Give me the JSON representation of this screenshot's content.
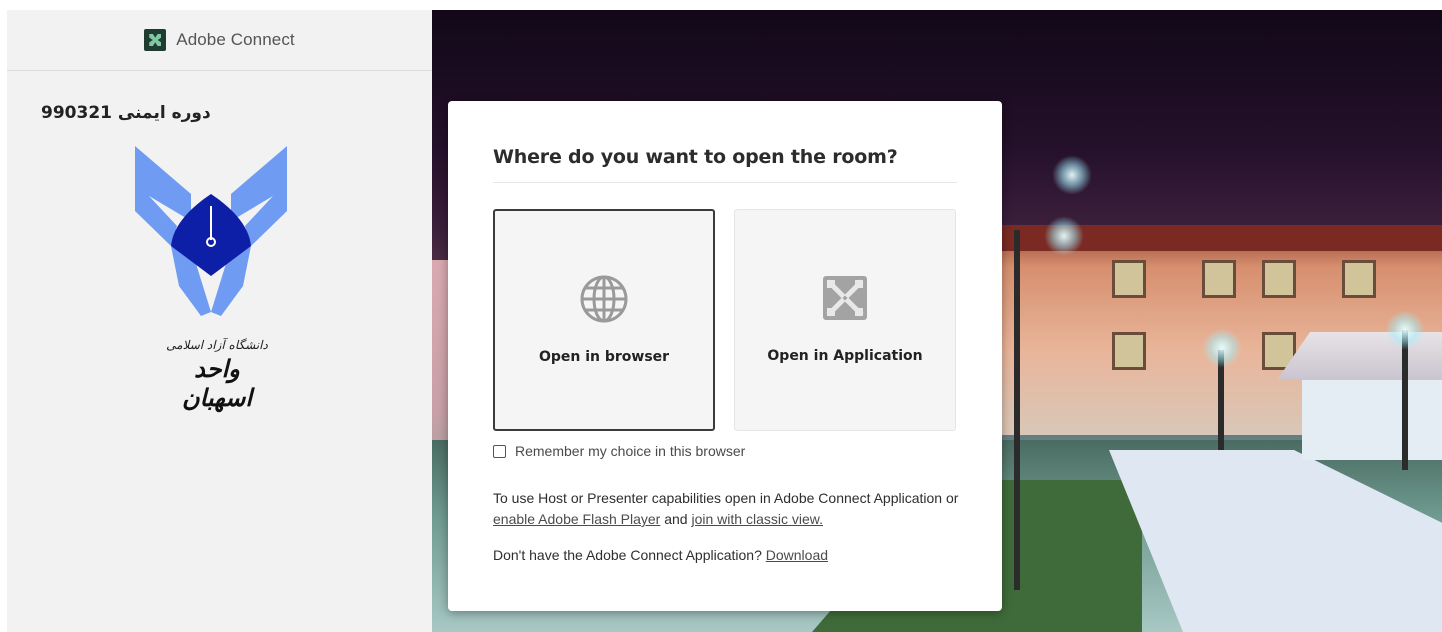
{
  "sidebar": {
    "brand_name": "Adobe Connect",
    "room_name": "دوره ایمنی 990321",
    "logo_caption_small": "دانشگاه آزاد اسلامی",
    "logo_caption_big": "واحد اسهبان",
    "logo_icon": "university-emblem-icon"
  },
  "dialog": {
    "title": "Where do you want to open the room?",
    "options": [
      {
        "label": "Open in browser",
        "icon": "globe-icon",
        "selected": true
      },
      {
        "label": "Open in Application",
        "icon": "adobe-connect-app-icon",
        "selected": false
      }
    ],
    "remember_label": "Remember my choice in this browser",
    "remember_checked": false,
    "info_text_1": "To use Host or Presenter capabilities open in Adobe Connect Application or ",
    "info_link_flash": "enable Adobe Flash Player",
    "info_text_2": " and ",
    "info_link_classic": "join with classic view.",
    "download_prompt": "Don't have the Adobe Connect Application? ",
    "download_link": "Download"
  },
  "colors": {
    "brand_dark": "#1f3b32",
    "emblem_light_blue": "#6f9cf2",
    "emblem_dark_blue": "#0d1fa6",
    "dialog_bg": "#ffffff",
    "sidebar_bg": "#f2f2f2"
  }
}
